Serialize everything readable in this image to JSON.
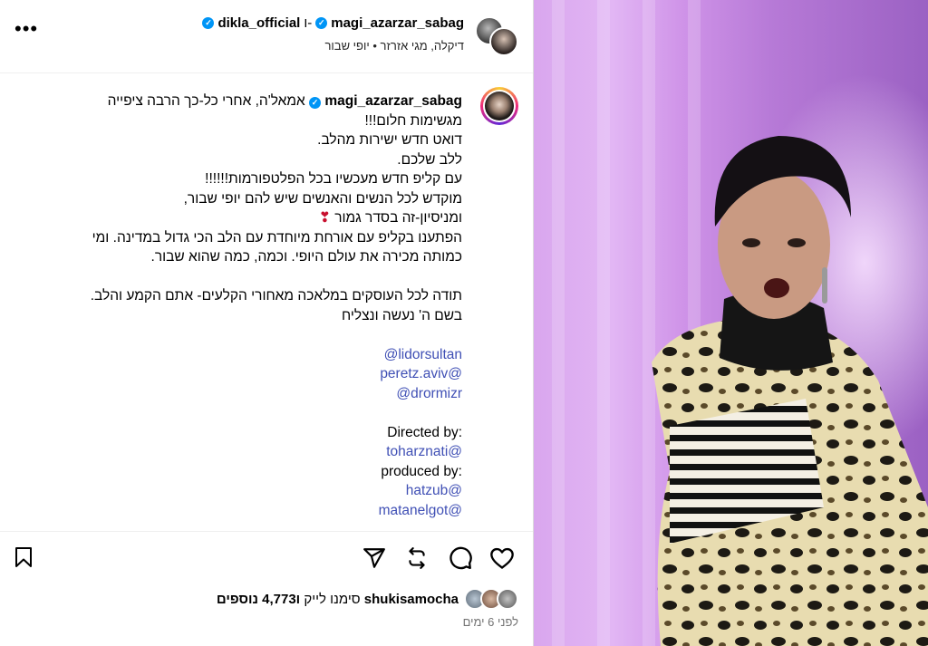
{
  "header": {
    "user_primary": "magi_azarzar_sabag",
    "connector": "ו-",
    "user_secondary": "dikla_official",
    "subtitle": "דיקלה, מגי אזרזר • יופי שבור",
    "more_icon": "more-horizontal-icon"
  },
  "caption": {
    "username": "magi_azarzar_sabag",
    "lines": [
      "אמאל'ה, אחרי כל-כך הרבה ציפייה",
      "מגשימות חלום!!!",
      "דואט חדש ישירות מהלב.",
      "ללב שלכם.",
      "עם קליפ חדש מעכשיו בכל הפלטפורמות!!!!!!",
      "מוקדש לכל הנשים והאנשים שיש להם יופי שבור,",
      "ומניסיון-זה בסדר גמור",
      "הפתענו בקליפ עם אורחת מיוחדת עם הלב הכי גדול במדינה. ומי",
      "כמותה מכירה את עולם היופי. וכמה, כמה שהוא שבור.",
      "",
      "תודה לכל העוסקים במלאכה מאחורי הקלעים- אתם הקמע והלב.",
      "בשם ה' נעשה ונצליח",
      "",
      "@lidorsultan",
      "peretz.aviv@",
      "@drormizr",
      "",
      "Directed by:",
      "toharznati@",
      "produced by:",
      "hatzub@",
      "matanelgot@"
    ],
    "heart_emoji": "❣"
  },
  "actions": {
    "like_icon": "heart-icon",
    "comment_icon": "comment-icon",
    "repost_icon": "repost-icon",
    "share_icon": "send-icon",
    "save_icon": "bookmark-icon"
  },
  "likes": {
    "user": "shukisamocha",
    "count_prefix": "ו",
    "count": "4,773",
    "others_text": "נוספים",
    "suffix": "סימנו לייק"
  },
  "timestamp": "לפני 6 ימים",
  "colors": {
    "verified": "#0095f6",
    "link": "#4050b5",
    "muted": "#737373"
  }
}
